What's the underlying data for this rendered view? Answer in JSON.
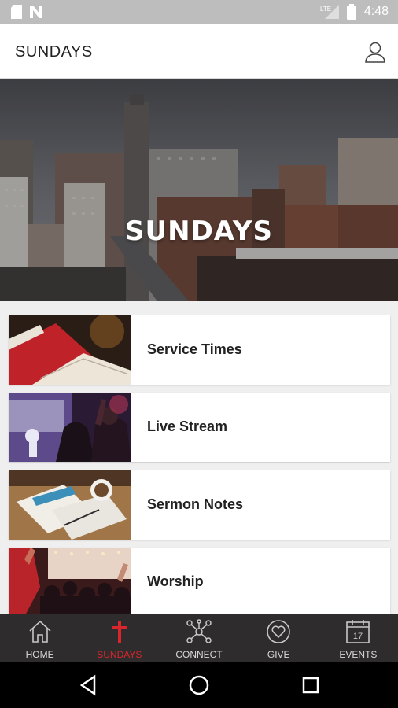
{
  "status_bar": {
    "time": "4:48",
    "network": "LTE"
  },
  "app_bar": {
    "title": "SUNDAYS",
    "profile_icon": "user-icon"
  },
  "hero": {
    "title": "SUNDAYS",
    "accent_color": "#d9252c"
  },
  "menu": {
    "items": [
      {
        "label": "Service Times",
        "image": "bible-photo"
      },
      {
        "label": "Live Stream",
        "image": "concert-photo"
      },
      {
        "label": "Sermon Notes",
        "image": "notebook-coffee-photo"
      },
      {
        "label": "Worship",
        "image": "worship-crowd-photo"
      }
    ]
  },
  "bottom_nav": {
    "active": "SUNDAYS",
    "active_color": "#d9252c",
    "items": [
      {
        "label": "HOME",
        "icon": "home-icon"
      },
      {
        "label": "SUNDAYS",
        "icon": "cross-icon"
      },
      {
        "label": "CONNECT",
        "icon": "network-icon"
      },
      {
        "label": "GIVE",
        "icon": "heart-icon"
      },
      {
        "label": "EVENTS",
        "icon": "calendar-icon",
        "calendar_day": "17"
      }
    ]
  }
}
